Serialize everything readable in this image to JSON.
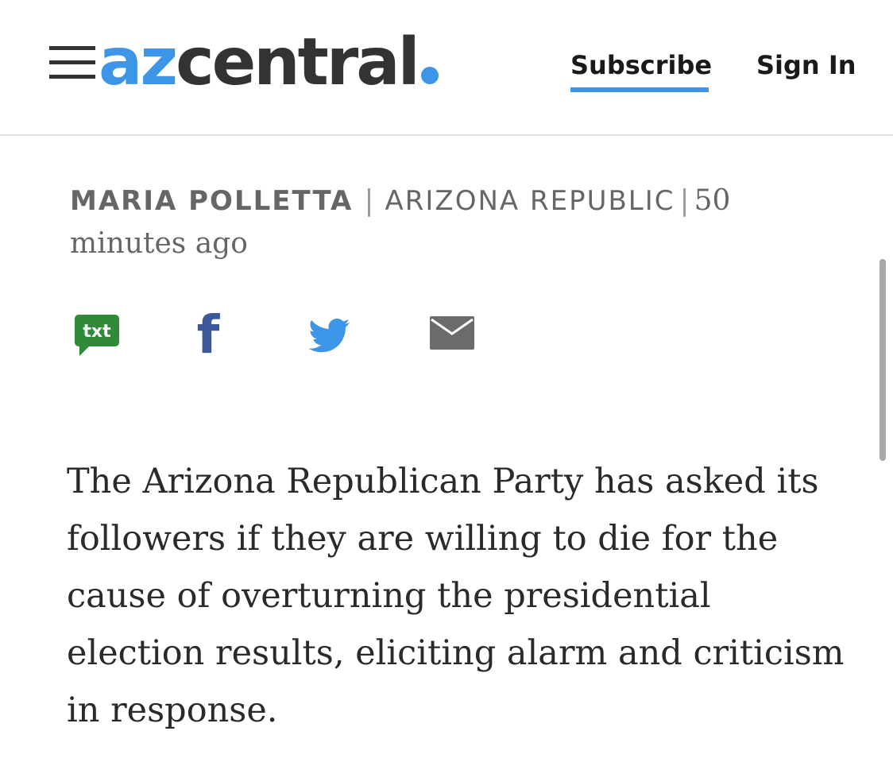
{
  "header": {
    "menu_icon": "hamburger-menu-icon",
    "logo": {
      "prefix": "az",
      "rest": "central",
      "accent_color": "#3d95e8",
      "text_color": "#333333"
    },
    "subscribe_label": "Subscribe",
    "signin_label": "Sign In"
  },
  "byline": {
    "author": "MARIA POLLETTA",
    "separator": "|",
    "organization": "ARIZONA REPUBLIC",
    "time": "50 minutes ago"
  },
  "share": {
    "items": [
      {
        "icon": "txt-sms-icon",
        "label": "txt",
        "color": "#2f8a3a"
      },
      {
        "icon": "facebook-icon",
        "label": "f",
        "color": "#3b5998"
      },
      {
        "icon": "twitter-icon",
        "color": "#3d95e8"
      },
      {
        "icon": "email-icon",
        "color": "#6b6b6b"
      }
    ]
  },
  "article": {
    "lead": "The Arizona Republican Party has asked its followers if they are willing to die for the cause of overturning the presidential election results, eliciting alarm and criticism in response."
  }
}
